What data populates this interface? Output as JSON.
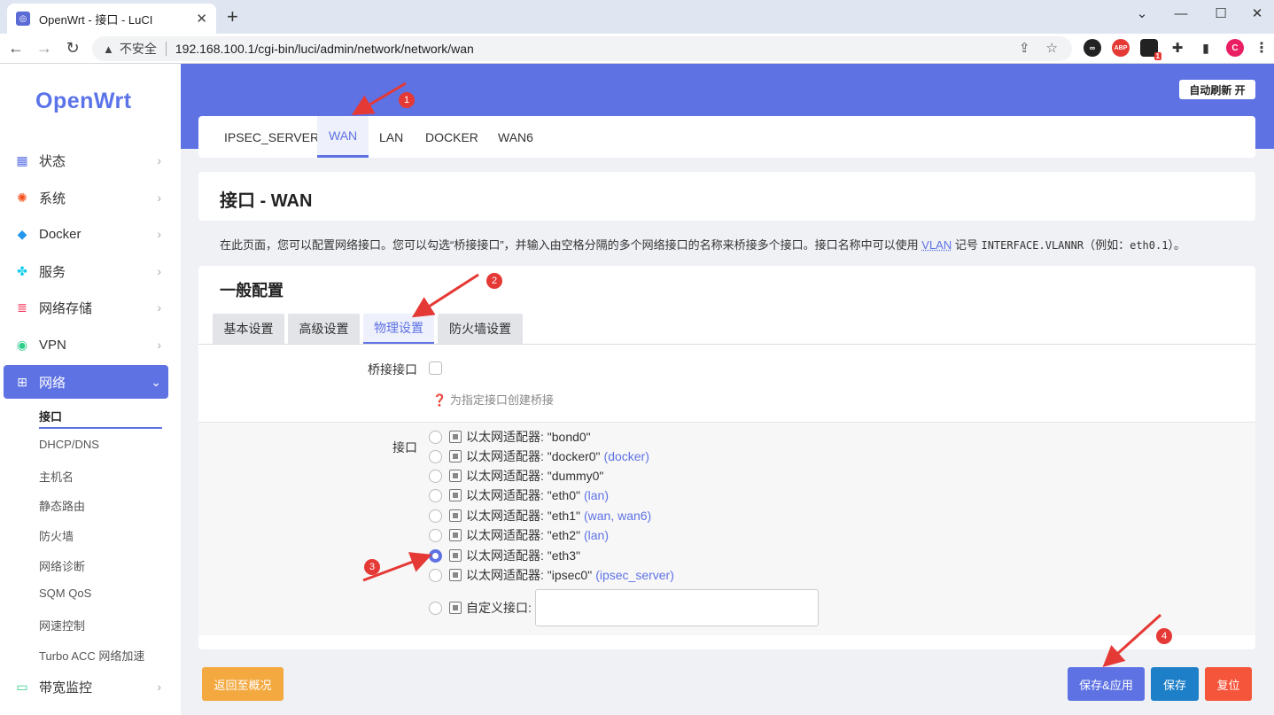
{
  "browser": {
    "tab_title": "OpenWrt - 接口 - LuCI",
    "tab_close": "✕",
    "new_tab": "+",
    "window_controls": [
      "⌄",
      "—",
      "☐",
      "✕"
    ],
    "security_label": "不安全",
    "url": "192.168.100.1/cgi-bin/luci/admin/network/network/wan",
    "ext_abp": "ABP",
    "ext_badge": "1",
    "profile": "C"
  },
  "sidebar": {
    "logo": "OpenWrt",
    "menu": [
      {
        "label": "状态",
        "icon": "dashboard-icon"
      },
      {
        "label": "系统",
        "icon": "gear-icon"
      },
      {
        "label": "Docker",
        "icon": "docker-icon"
      },
      {
        "label": "服务",
        "icon": "puzzle-icon"
      },
      {
        "label": "网络存储",
        "icon": "database-icon"
      },
      {
        "label": "VPN",
        "icon": "globe-icon"
      },
      {
        "label": "网络",
        "icon": "network-icon"
      },
      {
        "label": "带宽监控",
        "icon": "monitor-icon"
      }
    ],
    "submenu": [
      "接口",
      "DHCP/DNS",
      "主机名",
      "静态路由",
      "防火墙",
      "网络诊断",
      "SQM QoS",
      "网速控制",
      "Turbo ACC 网络加速"
    ]
  },
  "header": {
    "refresh_label": "自动刷新 开"
  },
  "interface_tabs": [
    "IPSEC_SERVER",
    "WAN",
    "LAN",
    "DOCKER",
    "WAN6"
  ],
  "page": {
    "title": "接口 - WAN",
    "desc_prefix": "在此页面，您可以配置网络接口。您可以勾选“桥接接口”，并输入由空格分隔的多个网络接口的名称来桥接多个接口。接口名称中可以使用 ",
    "desc_vlan": "VLAN",
    "desc_mid": " 记号 ",
    "desc_code": "INTERFACE.VLANNR",
    "desc_example": "（例如：",
    "desc_code2": "eth0.1",
    "desc_suffix": "）。"
  },
  "general": {
    "title": "一般配置",
    "tabs": [
      "基本设置",
      "高级设置",
      "物理设置",
      "防火墙设置"
    ],
    "bridge_label": "桥接接口",
    "bridge_hint": "为指定接口创建桥接",
    "iface_label": "接口",
    "options": [
      {
        "label": "以太网适配器: \"bond0\"",
        "net": "",
        "checked": false
      },
      {
        "label": "以太网适配器: \"docker0\"",
        "net": "(docker)",
        "checked": false
      },
      {
        "label": "以太网适配器: \"dummy0\"",
        "net": "",
        "checked": false
      },
      {
        "label": "以太网适配器: \"eth0\"",
        "net": "(lan)",
        "checked": false
      },
      {
        "label": "以太网适配器: \"eth1\"",
        "net": "(wan, wan6)",
        "checked": false
      },
      {
        "label": "以太网适配器: \"eth2\"",
        "net": "(lan)",
        "checked": false
      },
      {
        "label": "以太网适配器: \"eth3\"",
        "net": "",
        "checked": true
      },
      {
        "label": "以太网适配器: \"ipsec0\"",
        "net": "(ipsec_server)",
        "checked": false
      }
    ],
    "custom_label": "自定义接口:",
    "custom_value": ""
  },
  "footer": {
    "back": "返回至概况",
    "save_apply": "保存&应用",
    "save": "保存",
    "reset": "复位"
  },
  "annotations": [
    "1",
    "2",
    "3",
    "4"
  ],
  "colors": {
    "accent": "#5e72e4",
    "back_btn": "#f4a940",
    "save_apply_btn": "#5e72e4",
    "save_btn": "#1e7fc9",
    "reset_btn": "#f5553b",
    "annotation": "#e53935"
  }
}
